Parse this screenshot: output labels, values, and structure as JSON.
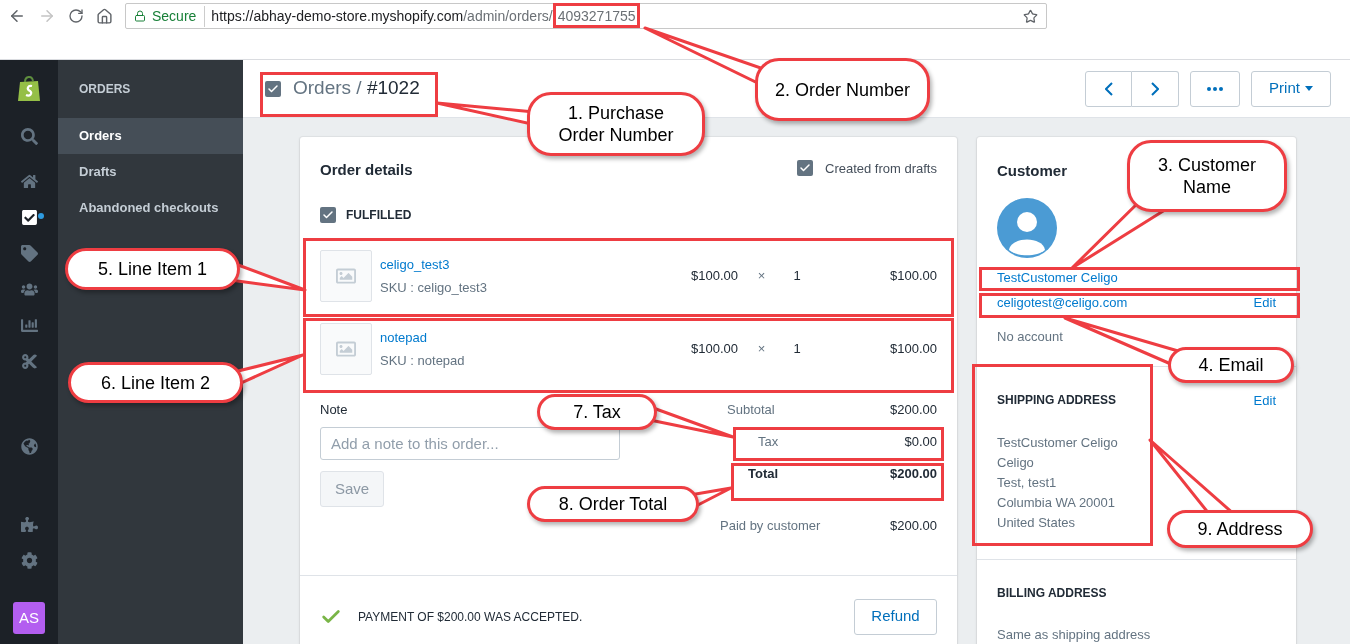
{
  "browser": {
    "secure_label": "Secure",
    "url_host": "https://abhay-demo-store.myshopify.com",
    "url_path": "/admin/orders/",
    "url_id": "4093271755"
  },
  "rail": {
    "items": [
      {
        "kind": "search",
        "selected": false,
        "notification": false
      },
      {
        "kind": "home",
        "selected": false,
        "notification": false
      },
      {
        "kind": "orders",
        "selected": true,
        "notification": true
      },
      {
        "kind": "products",
        "selected": false,
        "notification": false
      },
      {
        "kind": "customers",
        "selected": false,
        "notification": false
      },
      {
        "kind": "analytics",
        "selected": false,
        "notification": false
      },
      {
        "kind": "discounts",
        "selected": false,
        "notification": false
      },
      {
        "kind": "online_store",
        "selected": false,
        "notification": false
      },
      {
        "kind": "apps",
        "selected": false,
        "notification": false
      },
      {
        "kind": "settings",
        "selected": false,
        "notification": false
      }
    ],
    "avatar_initials": "AS"
  },
  "section_nav": {
    "title": "ORDERS",
    "items": [
      {
        "label": "Orders",
        "selected": true
      },
      {
        "label": "Drafts",
        "selected": false
      },
      {
        "label": "Abandoned checkouts",
        "selected": false
      }
    ]
  },
  "header": {
    "parent": "Orders",
    "separator": "/",
    "order_number": "#1022",
    "print_label": "Print"
  },
  "order_details": {
    "title": "Order details",
    "source_label": "Created from drafts",
    "fulfillment_status": "FULFILLED",
    "line_items": [
      {
        "name": "celigo_test3",
        "sku": "SKU : celigo_test3",
        "price": "$100.00",
        "times": "×",
        "quantity": "1",
        "total": "$100.00"
      },
      {
        "name": "notepad",
        "sku": "SKU : notepad",
        "price": "$100.00",
        "times": "×",
        "quantity": "1",
        "total": "$100.00"
      }
    ],
    "note": {
      "label": "Note",
      "placeholder": "Add a note to this order...",
      "save_label": "Save",
      "save_disabled": true
    },
    "summary": [
      {
        "kind": "subtotal",
        "label": "Subtotal",
        "value": "$200.00"
      },
      {
        "kind": "tax",
        "label": "Tax",
        "value": "$0.00"
      },
      {
        "kind": "total",
        "label": "Total",
        "value": "$200.00"
      },
      {
        "kind": "paid",
        "label": "Paid by customer",
        "value": "$200.00"
      }
    ],
    "payment": {
      "message": "PAYMENT OF $200.00 WAS ACCEPTED.",
      "refund_label": "Refund"
    }
  },
  "customer": {
    "title": "Customer",
    "name": "TestCustomer Celigo",
    "email": "celigotest@celigo.com",
    "edit_label": "Edit",
    "account_status": "No account",
    "shipping": {
      "title": "SHIPPING ADDRESS",
      "edit_label": "Edit",
      "lines": [
        "TestCustomer Celigo",
        "Celigo",
        "Test, test1",
        "Columbia WA 20001",
        "United States"
      ]
    },
    "billing": {
      "title": "BILLING ADDRESS",
      "text": "Same as shipping address"
    }
  },
  "annotations": [
    "1. Purchase Order Number",
    "2. Order Number",
    "3. Customer Name",
    "4. Email",
    "5. Line Item 1",
    "6. Line Item 2",
    "7. Tax",
    "8. Order Total",
    "9. Address"
  ]
}
